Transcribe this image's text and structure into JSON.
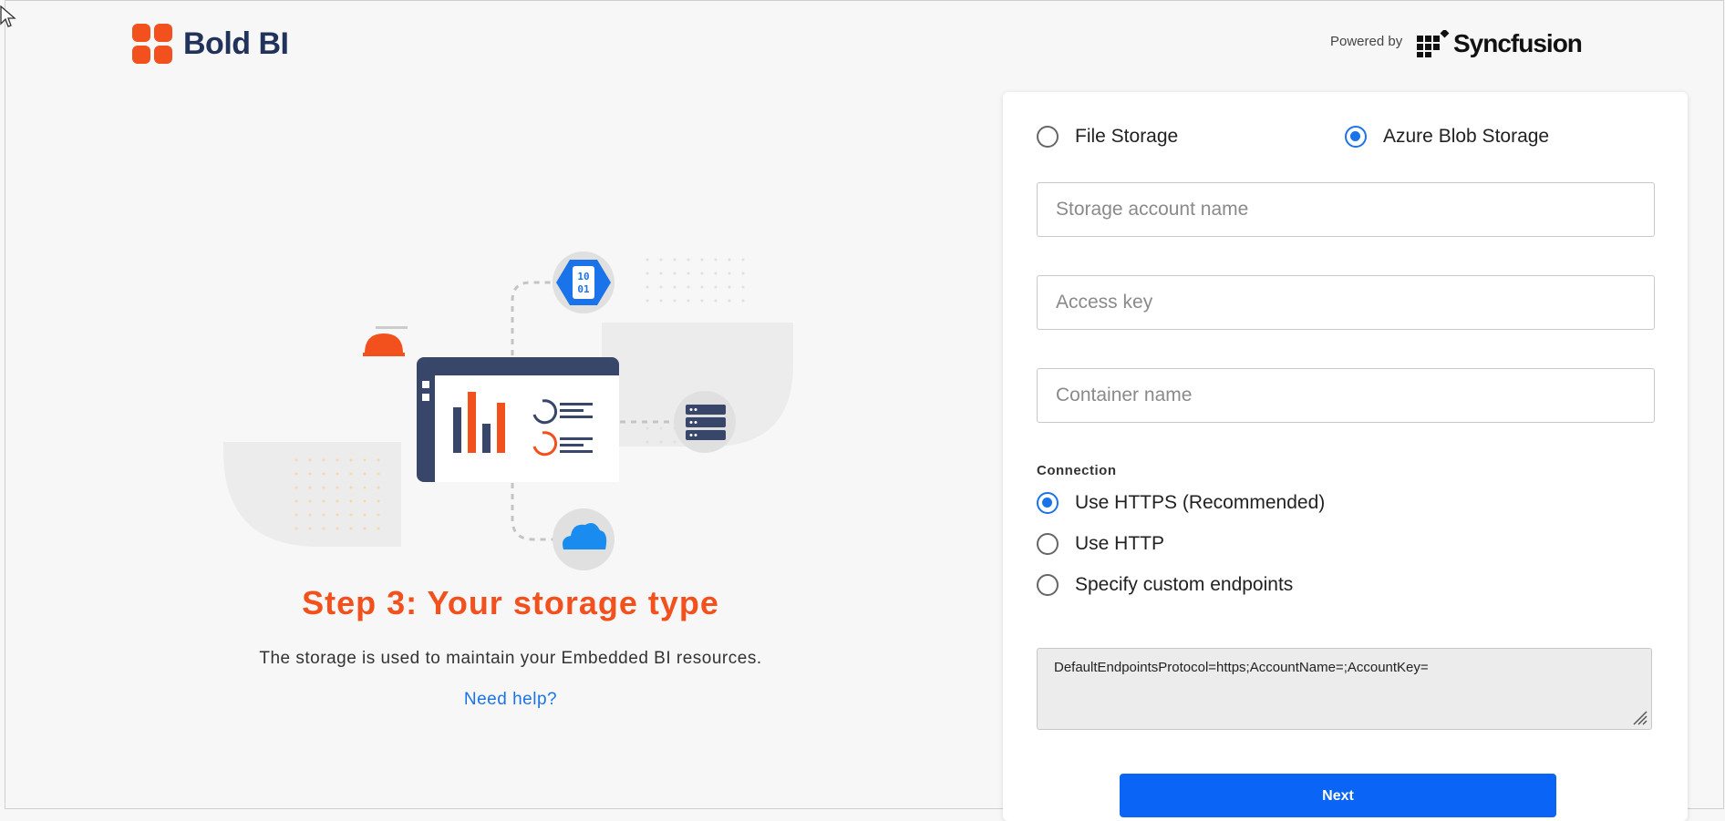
{
  "header": {
    "logo_text": "Bold BI",
    "powered_by": "Powered by",
    "partner_logo_text": "Syncfusion"
  },
  "left": {
    "step_title": "Step 3: Your storage type",
    "description": "The storage is used to maintain your Embedded BI resources.",
    "help_link": "Need help?"
  },
  "storage_options": [
    {
      "label": "File Storage",
      "selected": false
    },
    {
      "label": "Azure Blob Storage",
      "selected": true
    }
  ],
  "fields": {
    "account_name_placeholder": "Storage account name",
    "access_key_placeholder": "Access key",
    "container_placeholder": "Container name"
  },
  "connection": {
    "label": "Connection",
    "options": [
      {
        "label": "Use HTTPS (Recommended)",
        "selected": true
      },
      {
        "label": "Use HTTP",
        "selected": false
      },
      {
        "label": "Specify custom endpoints",
        "selected": false
      }
    ],
    "connection_string": "DefaultEndpointsProtocol=https;AccountName=;AccountKey="
  },
  "actions": {
    "next_label": "Next"
  },
  "colors": {
    "brand_orange": "#f2501d",
    "brand_navy": "#22335b",
    "accent_blue": "#1a73e8",
    "button_blue": "#0a64f5"
  }
}
